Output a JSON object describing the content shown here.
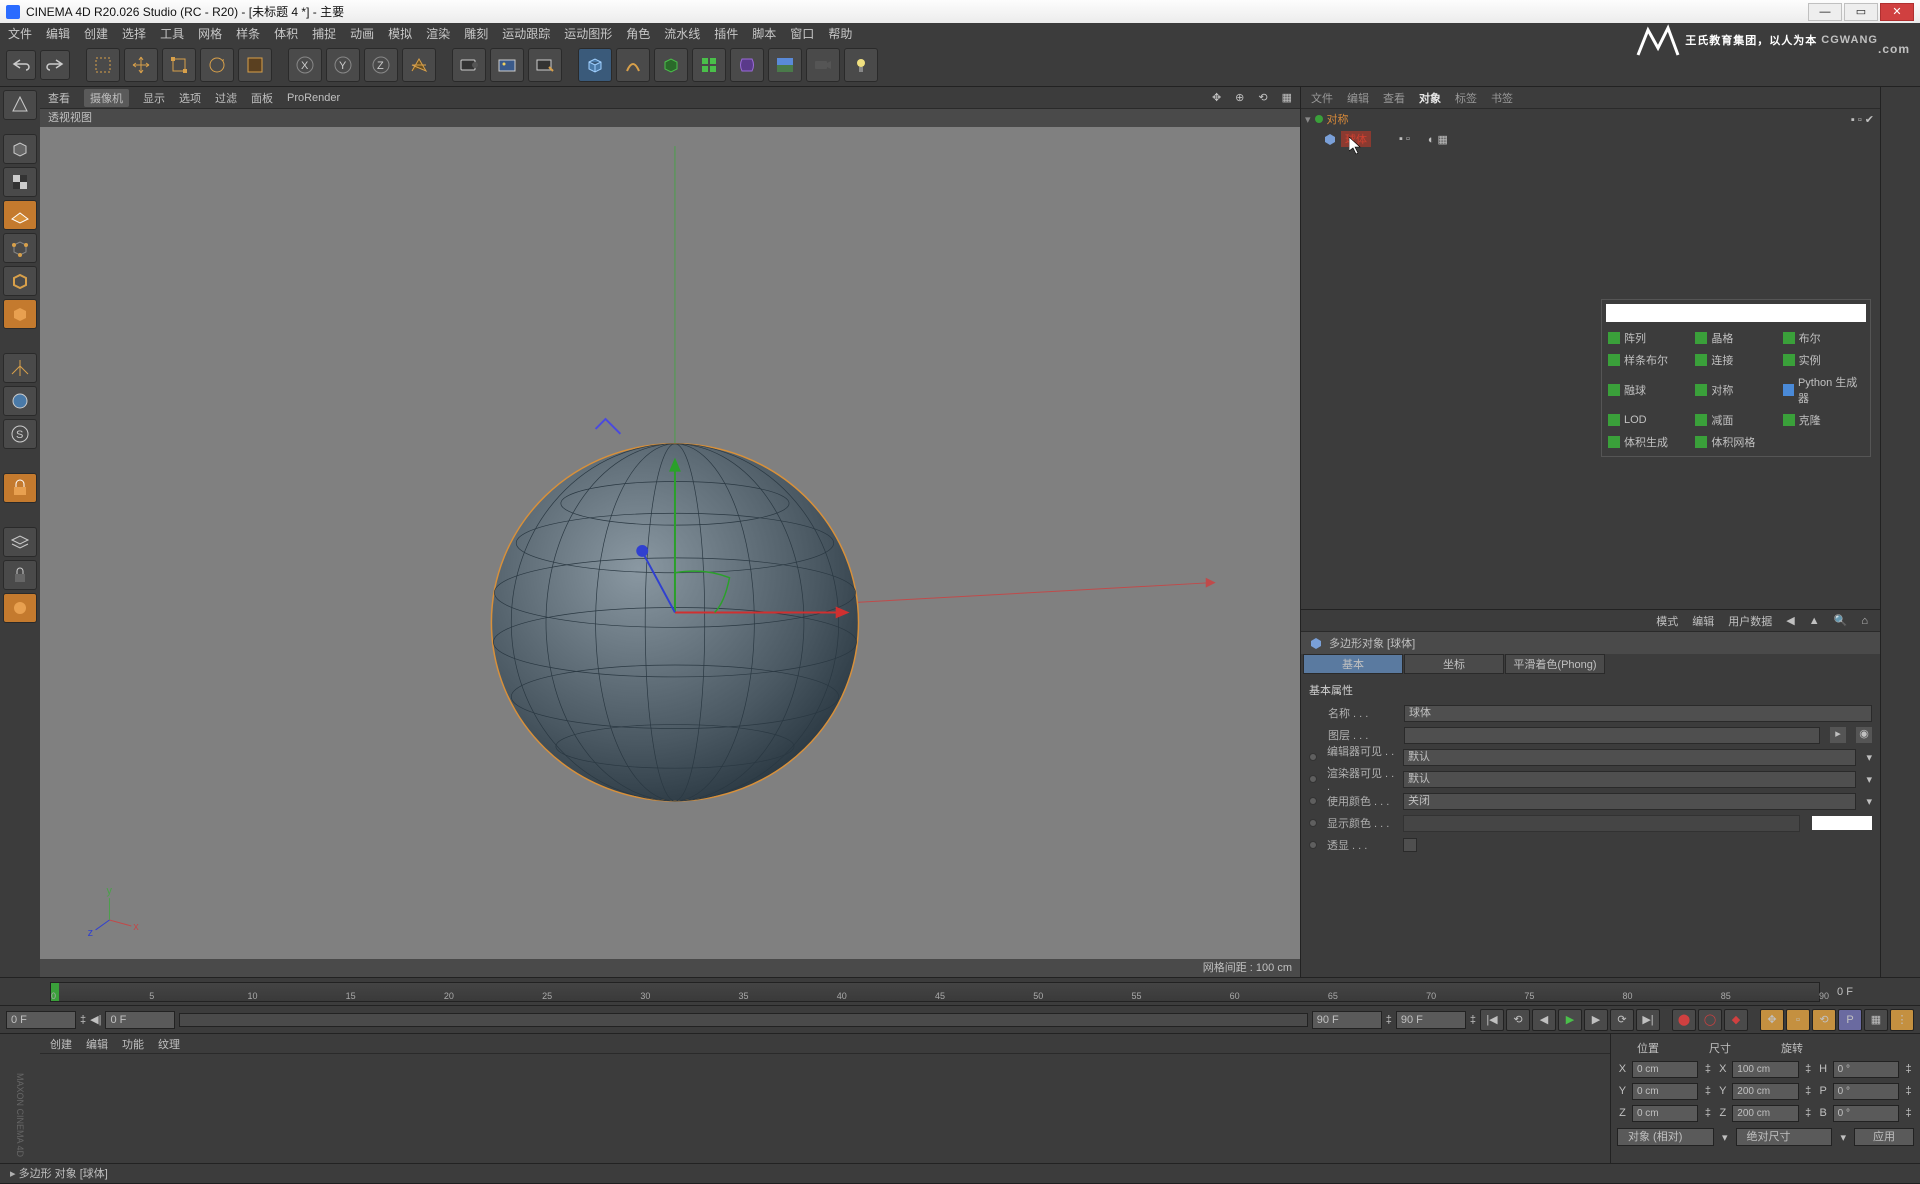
{
  "app": {
    "title": "CINEMA 4D R20.026 Studio (RC - R20) - [未标题 4 *] - 主要"
  },
  "menu": [
    "文件",
    "编辑",
    "创建",
    "选择",
    "工具",
    "网格",
    "样条",
    "体积",
    "捕捉",
    "动画",
    "模拟",
    "渲染",
    "雕刻",
    "运动跟踪",
    "运动图形",
    "角色",
    "流水线",
    "插件",
    "脚本",
    "窗口",
    "帮助"
  ],
  "viewBar": {
    "items": [
      "查看",
      "摄像机",
      "显示",
      "选项",
      "过滤",
      "面板",
      "ProRender"
    ],
    "active": 1,
    "label": "透视视图"
  },
  "viewFooter": "网格间距 : 100 cm",
  "objTabs": [
    "文件",
    "编辑",
    "查看",
    "对象",
    "标签",
    "书签"
  ],
  "objActive": 3,
  "objTree": {
    "root": {
      "name": "对称",
      "icon": "symmetry",
      "color": "#d88a3a"
    },
    "child": {
      "name": "球体",
      "icon": "poly",
      "color": "#7aa0d8"
    }
  },
  "popup": {
    "items": [
      [
        "阵列",
        "晶格",
        "布尔"
      ],
      [
        "样条布尔",
        "连接",
        "实例"
      ],
      [
        "融球",
        "对称",
        "Python 生成器"
      ],
      [
        "LOD",
        "减面",
        "克隆"
      ],
      [
        "体积生成",
        "体积网格",
        ""
      ]
    ],
    "iconColors": [
      [
        "#3aa03a",
        "#3aa03a",
        "#3aa03a"
      ],
      [
        "#3aa03a",
        "#3aa03a",
        "#3aa03a"
      ],
      [
        "#3aa03a",
        "#3aa03a",
        "#4a8ad8"
      ],
      [
        "#3aa03a",
        "#3aa03a",
        "#3aa03a"
      ],
      [
        "#3aa03a",
        "#3aa03a",
        ""
      ]
    ]
  },
  "attr": {
    "tabs": [
      "模式",
      "编辑",
      "用户数据"
    ],
    "header": "多边形对象 [球体]",
    "subtabs": [
      "基本",
      "坐标",
      "平滑着色(Phong)"
    ],
    "subActive": 0,
    "group": "基本属性",
    "rows": [
      {
        "label": "名称",
        "value": "球体",
        "type": "text"
      },
      {
        "label": "图层",
        "value": "",
        "type": "layer"
      },
      {
        "label": "编辑器可见",
        "value": "默认",
        "type": "drop",
        "dot": true
      },
      {
        "label": "渲染器可见",
        "value": "默认",
        "type": "drop",
        "dot": true
      },
      {
        "label": "使用颜色",
        "value": "关闭",
        "type": "drop",
        "dot": true
      },
      {
        "label": "显示颜色",
        "value": "",
        "type": "color",
        "dot": true,
        "disabled": true
      },
      {
        "label": "透显",
        "value": "",
        "type": "check",
        "dot": true
      }
    ]
  },
  "timeline": {
    "ticks": [
      0,
      5,
      10,
      15,
      20,
      25,
      30,
      35,
      40,
      45,
      50,
      55,
      60,
      65,
      70,
      75,
      80,
      85,
      90
    ]
  },
  "playbar": {
    "startF": "0 F",
    "rangeA": "0 F",
    "rangeB": "90 F",
    "curF": "90 F"
  },
  "matTabs": [
    "创建",
    "编辑",
    "功能",
    "纹理"
  ],
  "coord": {
    "headers": [
      "位置",
      "尺寸",
      "旋转"
    ],
    "rows": [
      {
        "axis": "X",
        "pos": "0 cm",
        "sizeA": "X",
        "size": "100 cm",
        "rotA": "H",
        "rot": "0 °"
      },
      {
        "axis": "Y",
        "pos": "0 cm",
        "sizeA": "Y",
        "size": "200 cm",
        "rotA": "P",
        "rot": "0 °"
      },
      {
        "axis": "Z",
        "pos": "0 cm",
        "sizeA": "Z",
        "size": "200 cm",
        "rotA": "B",
        "rot": "0 °"
      }
    ],
    "modeA": "对象 (相对)",
    "modeB": "绝对尺寸",
    "apply": "应用"
  },
  "status": "多边形 对象 [球体]",
  "watermark": {
    "brand": "CGWANG",
    "sub": "王氏教育集团，以人为本",
    "dotcom": ".com"
  }
}
